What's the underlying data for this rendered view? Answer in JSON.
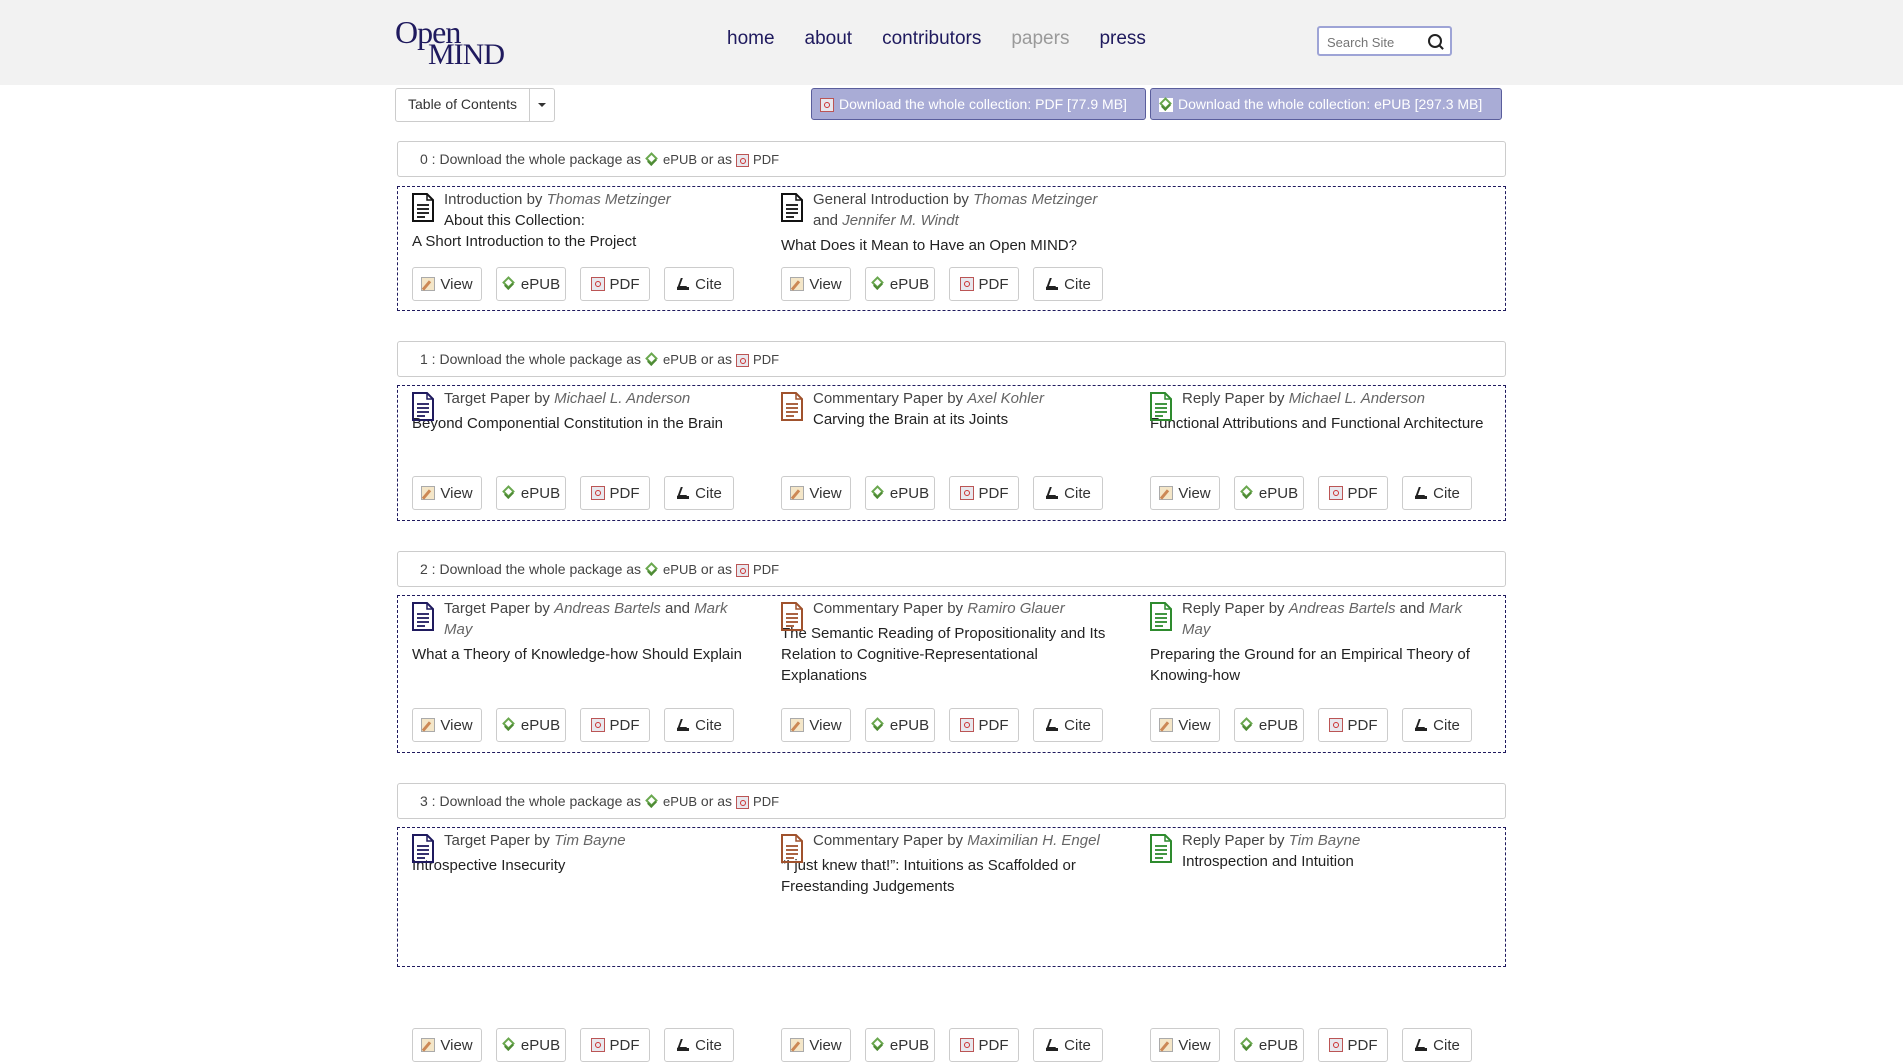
{
  "logo": {
    "line1": "Open",
    "line2": "MIND"
  },
  "nav": [
    {
      "label": "home"
    },
    {
      "label": "about"
    },
    {
      "label": "contributors"
    },
    {
      "label": "papers"
    },
    {
      "label": "press"
    }
  ],
  "search": {
    "placeholder": "Search Site"
  },
  "toc": {
    "label": "Table of Contents"
  },
  "download_pdf": "Download the whole collection: PDF [77.9 MB]",
  "download_epub": "Download the whole collection: ePUB [297.3 MB]",
  "pkg": {
    "text": "Download the whole package as",
    "epub": "ePUB",
    "or": "or as",
    "pdf": "PDF"
  },
  "buttons": {
    "view": "View",
    "epub": "ePUB",
    "pdf": "PDF",
    "cite": "Cite"
  },
  "colors": {
    "target": "#1f1a5e",
    "commentary": "#a0522d",
    "reply": "#2e8b2e",
    "intro": "#111111"
  },
  "sections": [
    {
      "num": "0 :",
      "papers": [
        {
          "type": "Introduction",
          "by": "by",
          "author1": "Thomas Metzinger",
          "and": "",
          "author2": "",
          "title": "About this Collection:",
          "title2": "A Short Introduction to the Project"
        },
        {
          "type": "General Introduction",
          "by": "by",
          "author1": "Thomas Metzinger",
          "and": "and",
          "author2": "Jennifer M. Windt",
          "title": "What Does it Mean to Have an Open MIND?",
          "title2": ""
        }
      ]
    },
    {
      "num": "1 :",
      "papers": [
        {
          "type": "Target Paper",
          "by": "by",
          "author1": "Michael L. Anderson",
          "and": "",
          "author2": "",
          "title": "Beyond Componential Constitution in the Brain",
          "title2": ""
        },
        {
          "type": "Commentary Paper",
          "by": "by",
          "author1": "Axel Kohler",
          "and": "",
          "author2": "",
          "title": "Carving the Brain at its Joints",
          "title2": ""
        },
        {
          "type": "Reply Paper",
          "by": "by",
          "author1": "Michael L. Anderson",
          "and": "",
          "author2": "",
          "title": "Functional Attributions and Functional Architecture",
          "title2": ""
        }
      ]
    },
    {
      "num": "2 :",
      "papers": [
        {
          "type": "Target Paper",
          "by": "by",
          "author1": "Andreas Bartels",
          "and": "and",
          "author2": "Mark May",
          "title": "What a Theory of Knowledge-how Should Explain",
          "title2": ""
        },
        {
          "type": "Commentary Paper",
          "by": "by",
          "author1": "Ramiro Glauer",
          "and": "",
          "author2": "",
          "title": "The Semantic Reading of Propositionality and Its Relation to Cognitive-Representational Explanations",
          "title2": ""
        },
        {
          "type": "Reply Paper",
          "by": "by",
          "author1": "Andreas Bartels",
          "and": "and",
          "author2": "Mark May",
          "title": "Preparing the Ground for an Empirical Theory of Knowing-how",
          "title2": ""
        }
      ]
    },
    {
      "num": "3 :",
      "papers": [
        {
          "type": "Target Paper",
          "by": "by",
          "author1": "Tim Bayne",
          "and": "",
          "author2": "",
          "title": "Introspective Insecurity",
          "title2": ""
        },
        {
          "type": "Commentary Paper",
          "by": "by",
          "author1": "Maximilian H. Engel",
          "and": "",
          "author2": "",
          "title": "“I just knew that!”: Intuitions as Scaffolded or Freestanding Judgements",
          "title2": ""
        },
        {
          "type": "Reply Paper",
          "by": "by",
          "author1": "Tim Bayne",
          "and": "",
          "author2": "",
          "title": "Introspection and Intuition",
          "title2": ""
        }
      ]
    }
  ]
}
